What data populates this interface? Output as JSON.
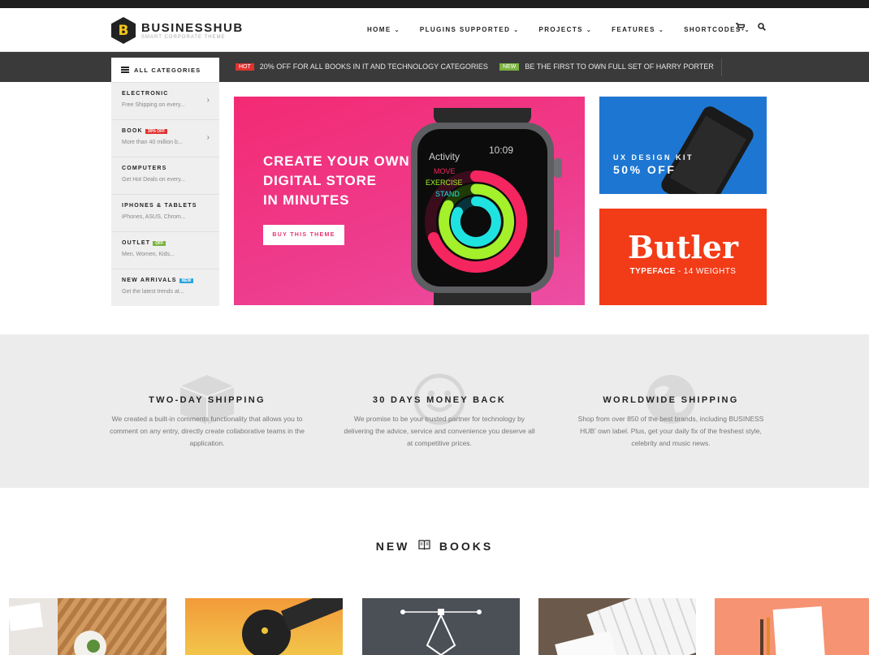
{
  "brand": {
    "name": "BUSINESSHUB",
    "tagline": "SMART CORPORATE THEME",
    "logo_letter": "B"
  },
  "nav": {
    "items": [
      "HOME",
      "PLUGINS SUPPORTED",
      "PROJECTS",
      "FEATURES",
      "SHORTCODES"
    ],
    "icons": [
      "cart-icon",
      "search-icon"
    ]
  },
  "promos": [
    {
      "badge": "HOT",
      "badge_color": "#e0332f",
      "text": "20% OFF FOR ALL BOOKS IN IT AND TECHNOLOGY CATEGORIES"
    },
    {
      "badge": "NEW",
      "badge_color": "#7cb342",
      "text": "BE THE FIRST TO OWN FULL SET OF HARRY PORTER"
    }
  ],
  "categories": {
    "header": "ALL CATEGORIES",
    "items": [
      {
        "title": "ELECTRONIC",
        "sub": "Free Shipping on every...",
        "badge": "",
        "has_arrow": true
      },
      {
        "title": "BOOK",
        "sub": "More than 40 million b...",
        "badge": "30% OFF",
        "badge_color": "#e0332f",
        "has_arrow": true
      },
      {
        "title": "COMPUTERS",
        "sub": "Get Hot Deals on every...",
        "badge": ""
      },
      {
        "title": "IPHONES & TABLETS",
        "sub": "iPhones, ASUS, Chrom...",
        "badge": ""
      },
      {
        "title": "OUTLET",
        "sub": "Men, Women, Kids...",
        "badge": "OFF",
        "badge_color": "#7cb342"
      },
      {
        "title": "NEW ARRIVALS",
        "sub": "Get the latest trends at...",
        "badge": "NEW",
        "badge_color": "#2ba6de"
      }
    ]
  },
  "hero": {
    "title_lines": [
      "CREATE YOUR OWN",
      "DIGITAL STORE",
      "IN MINUTES"
    ],
    "button": "BUY THIS THEME",
    "watch": {
      "time": "10:09",
      "app": "Activity",
      "rings": [
        "MOVE",
        "EXERCISE",
        "STAND"
      ]
    }
  },
  "promo_ux": {
    "line1": "UX DESIGN KIT",
    "line2": "50% OFF"
  },
  "promo_butler": {
    "name": "Butler",
    "sub_bold": "TYPEFACE",
    "sub_rest": " - 14 WEIGHTS"
  },
  "features": [
    {
      "icon": "box-icon",
      "title": "TWO-DAY SHIPPING",
      "text": "We created a built-in comments functionality that allows you to comment on any entry, directly create collaborative teams in the application."
    },
    {
      "icon": "smiley-icon",
      "title": "30 DAYS MONEY BACK",
      "text": "We promise to be your trusted partner for technology by delivering the advice, service and convenience you deserve all at competitive prices."
    },
    {
      "icon": "globe-icon",
      "title": "WORLDWIDE SHIPPING",
      "text": "Shop from over 850 of the best brands, including BUSINESS HUB' own label. Plus, get your daily fix of the freshest style, celebrity and music news."
    }
  ],
  "new_books": {
    "word1": "NEW",
    "word2": "BOOKS",
    "icon": "book-icon"
  },
  "colors": {
    "accent_pink": "#f32a73",
    "ux_blue": "#1d77d2",
    "butler_red": "#f23b17",
    "dark_bar": "#3a3a3a"
  }
}
